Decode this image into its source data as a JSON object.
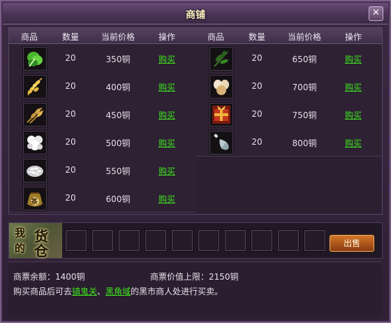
{
  "window": {
    "title": "商铺",
    "close_label": "✕"
  },
  "columns": {
    "item": "商品",
    "qty": "数量",
    "price": "当前价格",
    "action": "操作"
  },
  "goods_left": [
    {
      "icon": "green-vegetable-icon",
      "qty": "20",
      "price": "350铜",
      "action": "购买"
    },
    {
      "icon": "rice-ear-icon",
      "qty": "20",
      "price": "400铜",
      "action": "购买"
    },
    {
      "icon": "wheat-bundle-icon",
      "qty": "20",
      "price": "450铜",
      "action": "购买"
    },
    {
      "icon": "cotton-icon",
      "qty": "20",
      "price": "500铜",
      "action": "购买"
    },
    {
      "icon": "rice-grain-icon",
      "qty": "20",
      "price": "550铜",
      "action": "购买"
    },
    {
      "icon": "tea-bag-icon",
      "qty": "20",
      "price": "600铜",
      "action": "购买"
    }
  ],
  "goods_right": [
    {
      "icon": "herb-leaves-icon",
      "qty": "20",
      "price": "650铜",
      "action": "购买"
    },
    {
      "icon": "eggs-icon",
      "qty": "20",
      "price": "700铜",
      "action": "购买"
    },
    {
      "icon": "gift-box-icon",
      "qty": "20",
      "price": "750铜",
      "action": "购买"
    },
    {
      "icon": "wine-bottle-icon",
      "qty": "20",
      "price": "800铜",
      "action": "购买"
    }
  ],
  "tea_bag_text": "茶",
  "storage": {
    "label_chars": [
      "我",
      "的",
      "货",
      "仓"
    ],
    "slot_count": 10,
    "sell_label": "出售"
  },
  "info": {
    "balance_label": "商票余额：",
    "balance_value": "1400铜",
    "limit_label": "商票价值上限：",
    "limit_value": "2150铜",
    "notice_prefix": "购买商品后可去",
    "location_1": "镇鬼关",
    "separator": "、",
    "location_2": "黑角域",
    "notice_suffix": "的黑市商人处进行买卖。"
  },
  "colors": {
    "accent_green": "#3fe41d",
    "sell_button": "#c0621f",
    "title_text": "#fff3c9"
  }
}
